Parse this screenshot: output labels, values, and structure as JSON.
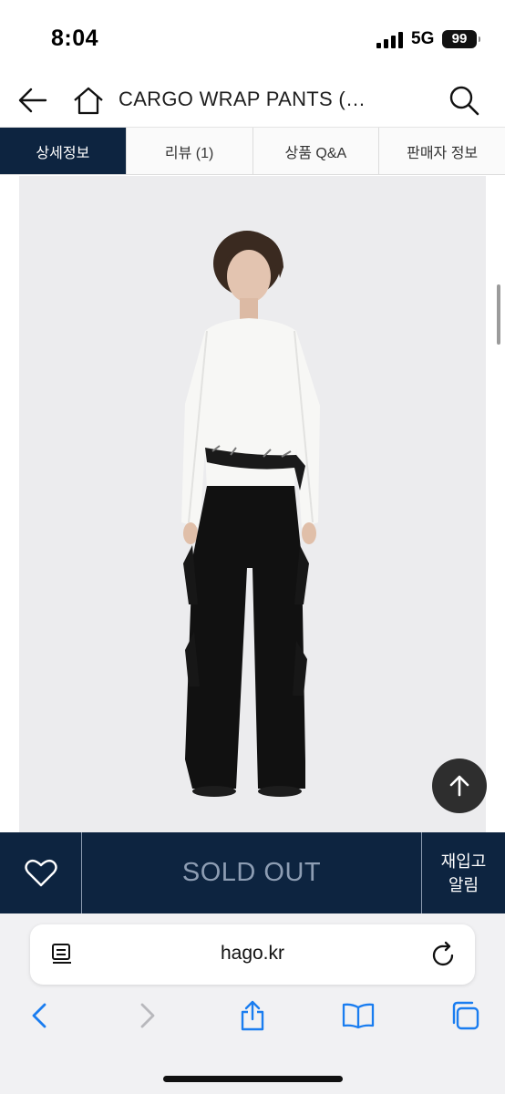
{
  "status_bar": {
    "time": "8:04",
    "network": "5G",
    "battery": "99"
  },
  "header": {
    "title": "CARGO WRAP PANTS (…"
  },
  "tabs": [
    {
      "label": "상세정보",
      "active": true
    },
    {
      "label": "리뷰 (1)",
      "active": false
    },
    {
      "label": "상품 Q&A",
      "active": false
    },
    {
      "label": "판매자 정보",
      "active": false
    }
  ],
  "product": {
    "image_alt": "CARGO WRAP PANTS"
  },
  "action_bar": {
    "sold_out_label": "SOLD OUT",
    "restock_line1": "재입고",
    "restock_line2": "알림"
  },
  "browser": {
    "url": "hago.kr"
  },
  "colors": {
    "navy": "#0d2440",
    "soldout_text": "#8d9db3",
    "safari_blue": "#1a7df0"
  }
}
